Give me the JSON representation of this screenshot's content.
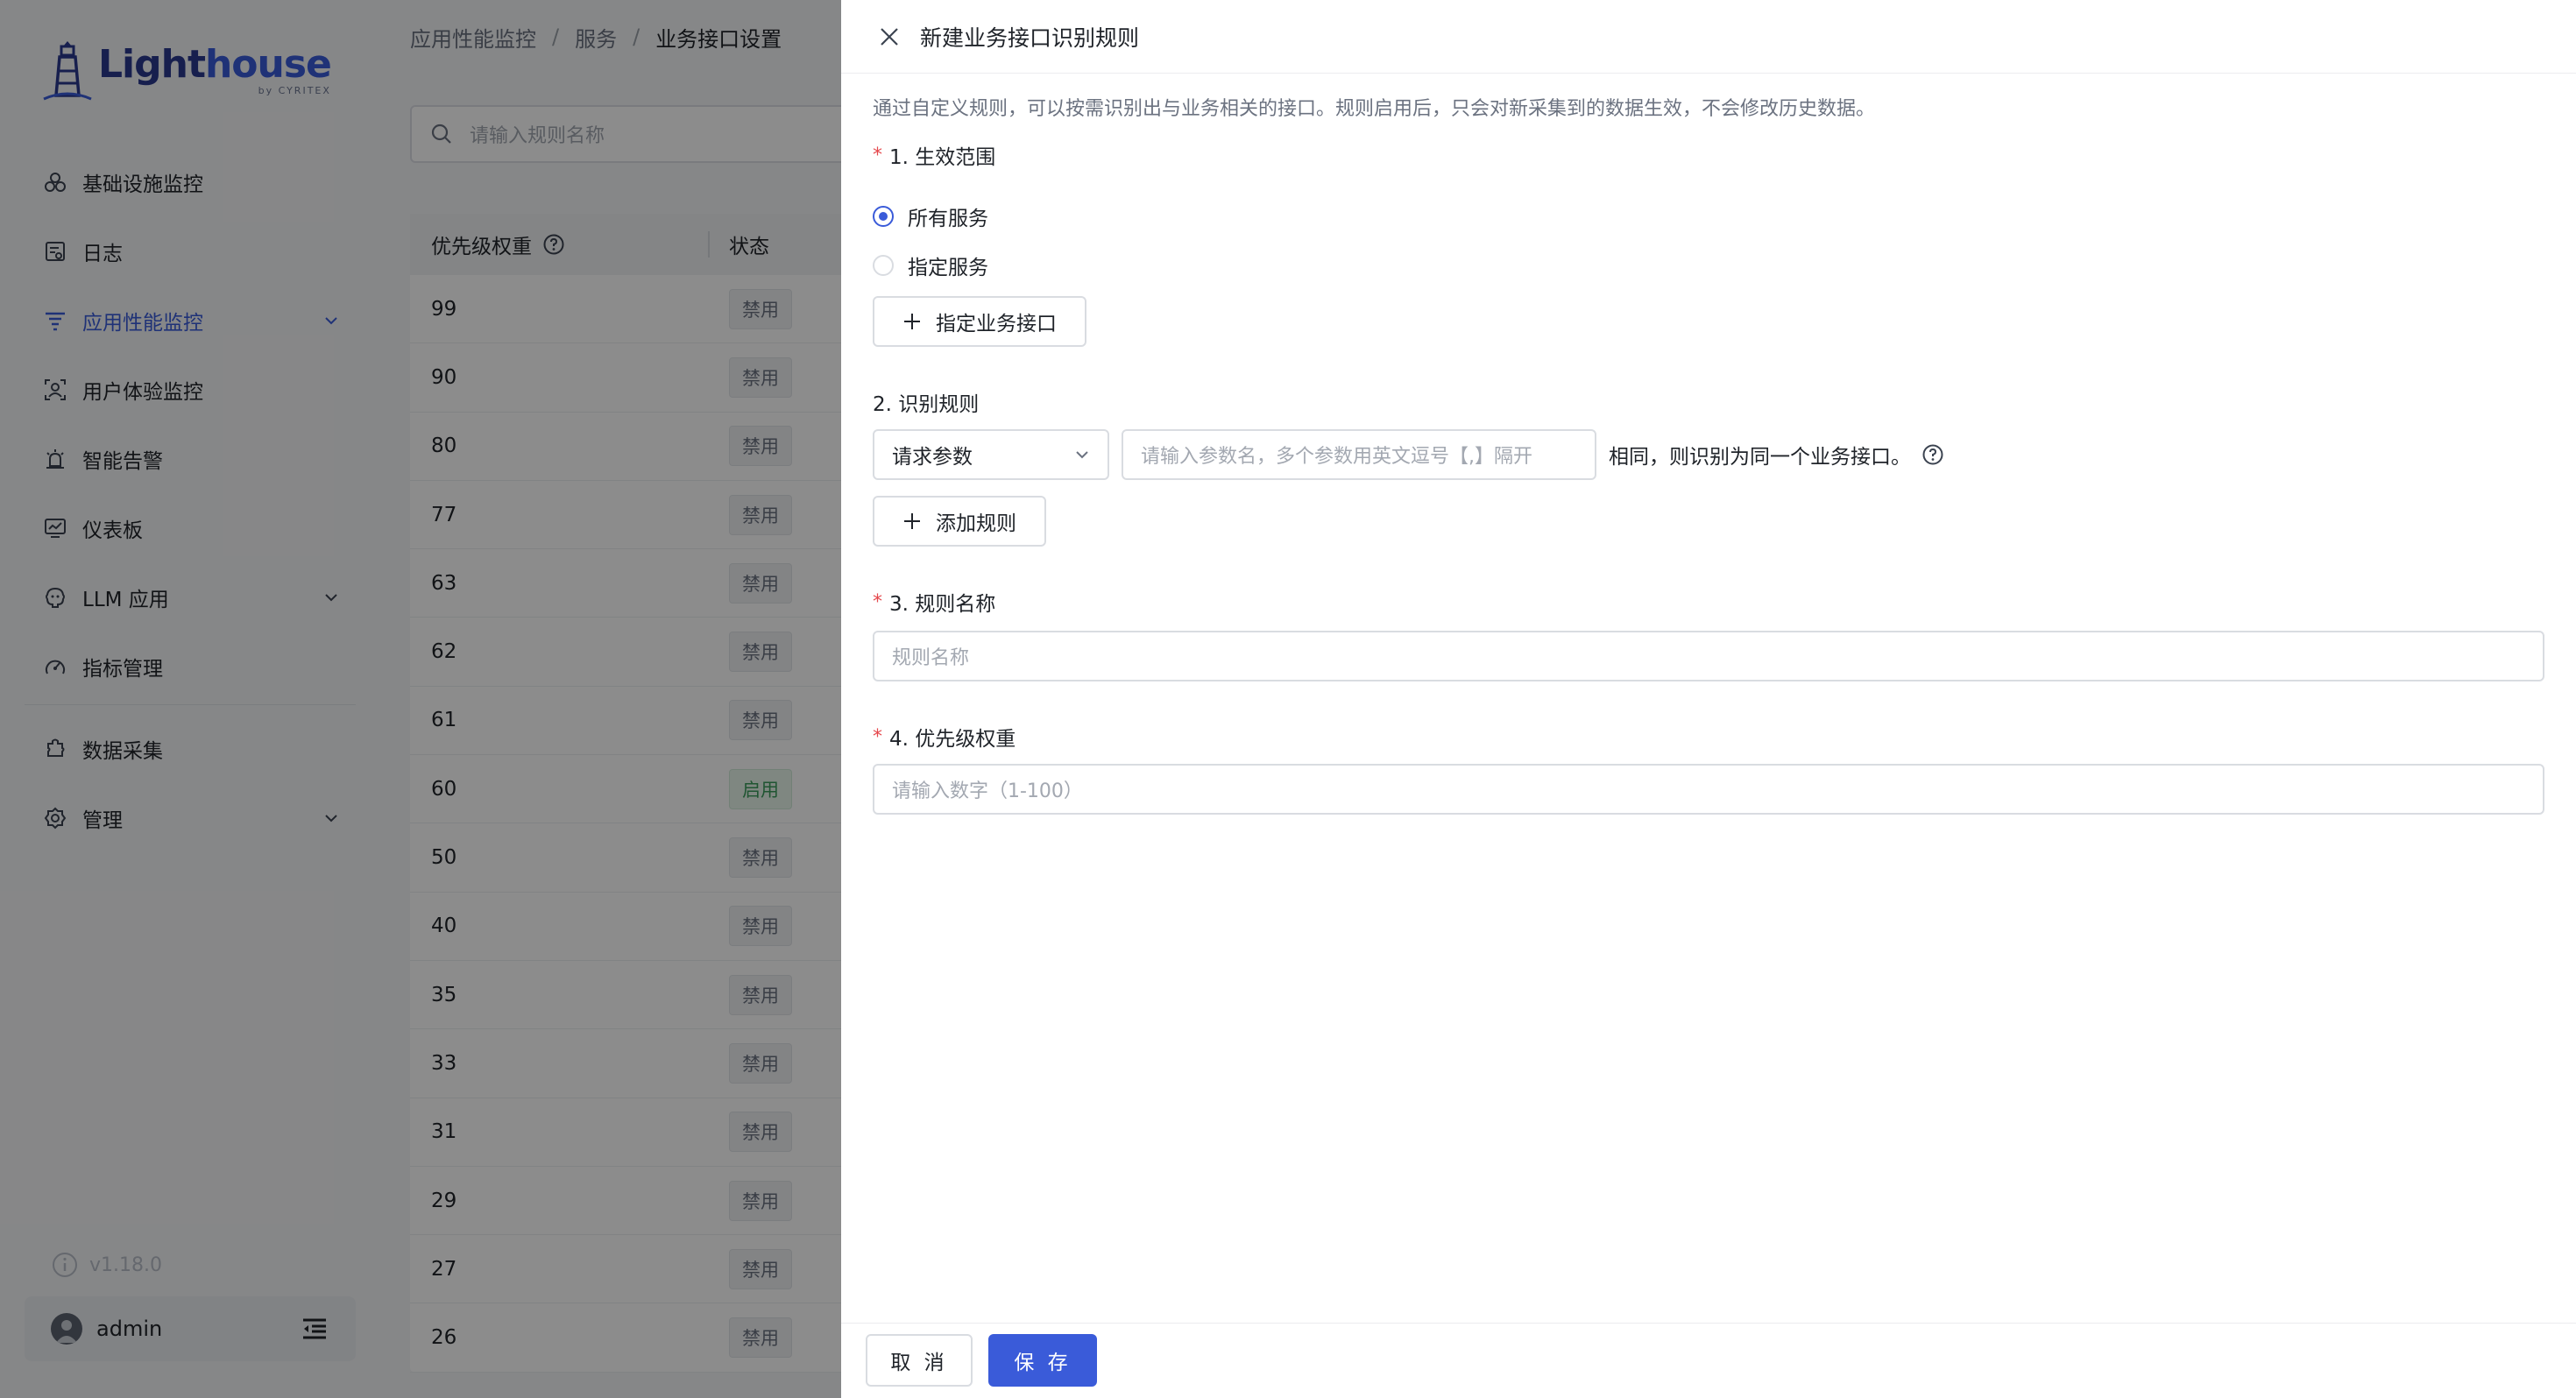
{
  "app": {
    "logo_text_a": "Light",
    "logo_text_b": "house",
    "logo_sub": "by CYRITEX",
    "version": "v1.18.0",
    "user": "admin"
  },
  "sidebar": {
    "items": [
      {
        "label": "基础设施监控",
        "icon": "infrastructure-icon"
      },
      {
        "label": "日志",
        "icon": "log-icon"
      },
      {
        "label": "应用性能监控",
        "icon": "apm-icon",
        "active": true
      },
      {
        "label": "用户体验监控",
        "icon": "user-experience-icon"
      },
      {
        "label": "智能告警",
        "icon": "alarm-icon"
      },
      {
        "label": "仪表板",
        "icon": "dashboard-icon"
      },
      {
        "label": "LLM 应用",
        "icon": "llm-icon"
      },
      {
        "label": "指标管理",
        "icon": "metrics-icon"
      },
      {
        "label": "数据采集",
        "icon": "data-collection-icon"
      },
      {
        "label": "管理",
        "icon": "settings-icon"
      }
    ]
  },
  "breadcrumb": [
    "应用性能监控",
    "服务",
    "业务接口设置"
  ],
  "search": {
    "placeholder": "请输入规则名称"
  },
  "table": {
    "headers": {
      "priority": "优先级权重",
      "status": "状态"
    },
    "rows": [
      {
        "priority": "99",
        "status": "禁用"
      },
      {
        "priority": "90",
        "status": "禁用"
      },
      {
        "priority": "80",
        "status": "禁用"
      },
      {
        "priority": "77",
        "status": "禁用"
      },
      {
        "priority": "63",
        "status": "禁用"
      },
      {
        "priority": "62",
        "status": "禁用"
      },
      {
        "priority": "61",
        "status": "禁用"
      },
      {
        "priority": "60",
        "status": "启用"
      },
      {
        "priority": "50",
        "status": "禁用"
      },
      {
        "priority": "40",
        "status": "禁用"
      },
      {
        "priority": "35",
        "status": "禁用"
      },
      {
        "priority": "33",
        "status": "禁用"
      },
      {
        "priority": "31",
        "status": "禁用"
      },
      {
        "priority": "29",
        "status": "禁用"
      },
      {
        "priority": "27",
        "status": "禁用"
      },
      {
        "priority": "26",
        "status": "禁用"
      }
    ]
  },
  "drawer": {
    "title": "新建业务接口识别规则",
    "description": "通过自定义规则，可以按需识别出与业务相关的接口。规则启用后，只会对新采集到的数据生效，不会修改历史数据。",
    "scope": {
      "label": "1. 生效范围",
      "option_all": "所有服务",
      "option_specified": "指定服务",
      "add_button": "指定业务接口"
    },
    "rule": {
      "label": "2. 识别规则",
      "select_value": "请求参数",
      "param_placeholder": "请输入参数名，多个参数用英文逗号【,】隔开",
      "suffix": "相同，则识别为同一个业务接口。",
      "add_button": "添加规则"
    },
    "name": {
      "label": "3. 规则名称",
      "placeholder": "规则名称"
    },
    "priority": {
      "label": "4. 优先级权重",
      "placeholder": "请输入数字（1-100）"
    },
    "footer": {
      "cancel": "取 消",
      "save": "保 存"
    }
  },
  "colors": {
    "accent": "#3a5bd9",
    "required": "#e5484d",
    "enabled": "#3b9b5b"
  }
}
